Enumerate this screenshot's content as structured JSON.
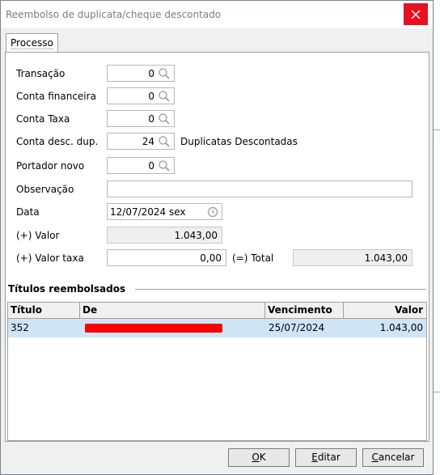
{
  "window": {
    "title": "Reembolso de duplicata/cheque descontado"
  },
  "tabs": [
    {
      "label": "Processo"
    }
  ],
  "form": {
    "transacao": {
      "label": "Transação",
      "value": "0"
    },
    "conta_financeira": {
      "label": "Conta financeira",
      "value": "0"
    },
    "conta_taxa": {
      "label": "Conta Taxa",
      "value": "0"
    },
    "conta_desc_dup": {
      "label": "Conta desc. dup.",
      "value": "24",
      "description": "Duplicatas Descontadas"
    },
    "portador_novo": {
      "label": "Portador novo",
      "value": "0"
    },
    "observacao": {
      "label": "Observação",
      "value": ""
    },
    "data": {
      "label": "Data",
      "value": "12/07/2024 sex"
    },
    "valor": {
      "label": "(+) Valor",
      "value": "1.043,00"
    },
    "valor_taxa": {
      "label": "(+) Valor taxa",
      "value": "0,00"
    },
    "total": {
      "label": "(=) Total",
      "value": "1.043,00"
    }
  },
  "titulos": {
    "section_title": "Títulos reembolsados",
    "columns": [
      "Título",
      "De",
      "Vencimento",
      "Valor"
    ],
    "rows": [
      {
        "titulo": "352",
        "de": "",
        "vencimento": "25/07/2024",
        "valor": "1.043,00"
      }
    ]
  },
  "buttons": {
    "ok": {
      "accel": "O",
      "rest": "K"
    },
    "editar": {
      "accel": "E",
      "rest": "ditar"
    },
    "cancelar": {
      "accel": "C",
      "rest": "ancelar"
    }
  },
  "colors": {
    "close": "#e81123",
    "selected_row": "#cfe5f7",
    "redaction": "#ff0000"
  },
  "icons": {
    "lookup": "magnifier-icon",
    "date": "clock-icon",
    "close": "close-icon"
  }
}
